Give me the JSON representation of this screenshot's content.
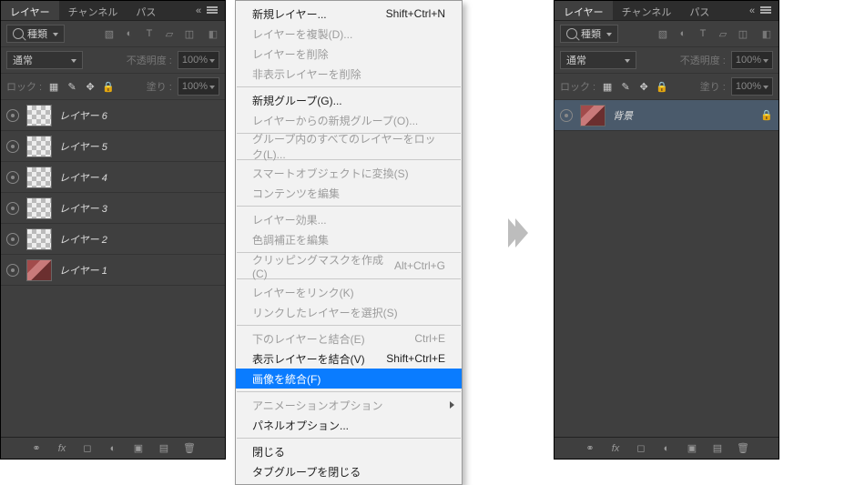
{
  "tabs": {
    "layers": "レイヤー",
    "channels": "チャンネル",
    "paths": "パス"
  },
  "filter": {
    "kind_label": "種類",
    "icons": [
      "image-icon",
      "adjust-icon",
      "type-icon",
      "shape-icon",
      "smart-icon"
    ]
  },
  "blend": {
    "mode": "通常",
    "opacity_label": "不透明度 :",
    "opacity_value": "100%"
  },
  "lock": {
    "label": "ロック :",
    "fill_label": "塗り :",
    "fill_value": "100%"
  },
  "leftLayers": [
    {
      "name": "レイヤー 6",
      "thumb": "checker"
    },
    {
      "name": "レイヤー 5",
      "thumb": "checker"
    },
    {
      "name": "レイヤー 4",
      "thumb": "checker"
    },
    {
      "name": "レイヤー 3",
      "thumb": "checker"
    },
    {
      "name": "レイヤー 2",
      "thumb": "checker"
    },
    {
      "name": "レイヤー 1",
      "thumb": "img"
    }
  ],
  "rightLayer": {
    "name": "背景",
    "locked": true
  },
  "menu": [
    {
      "t": "item",
      "label": "新規レイヤー...",
      "shortcut": "Shift+Ctrl+N"
    },
    {
      "t": "item",
      "label": "レイヤーを複製(D)...",
      "disabled": true
    },
    {
      "t": "item",
      "label": "レイヤーを削除",
      "disabled": true
    },
    {
      "t": "item",
      "label": "非表示レイヤーを削除",
      "disabled": true
    },
    {
      "t": "sep"
    },
    {
      "t": "item",
      "label": "新規グループ(G)..."
    },
    {
      "t": "item",
      "label": "レイヤーからの新規グループ(O)...",
      "disabled": true
    },
    {
      "t": "sep"
    },
    {
      "t": "item",
      "label": "グループ内のすべてのレイヤーをロック(L)...",
      "disabled": true
    },
    {
      "t": "sep"
    },
    {
      "t": "item",
      "label": "スマートオブジェクトに変換(S)",
      "disabled": true
    },
    {
      "t": "item",
      "label": "コンテンツを編集",
      "disabled": true
    },
    {
      "t": "sep"
    },
    {
      "t": "item",
      "label": "レイヤー効果...",
      "disabled": true
    },
    {
      "t": "item",
      "label": "色調補正を編集",
      "disabled": true
    },
    {
      "t": "sep"
    },
    {
      "t": "item",
      "label": "クリッピングマスクを作成(C)",
      "shortcut": "Alt+Ctrl+G",
      "disabled": true
    },
    {
      "t": "sep"
    },
    {
      "t": "item",
      "label": "レイヤーをリンク(K)",
      "disabled": true
    },
    {
      "t": "item",
      "label": "リンクしたレイヤーを選択(S)",
      "disabled": true
    },
    {
      "t": "sep"
    },
    {
      "t": "item",
      "label": "下のレイヤーと結合(E)",
      "shortcut": "Ctrl+E",
      "disabled": true
    },
    {
      "t": "item",
      "label": "表示レイヤーを結合(V)",
      "shortcut": "Shift+Ctrl+E"
    },
    {
      "t": "item",
      "label": "画像を統合(F)",
      "selected": true
    },
    {
      "t": "sep"
    },
    {
      "t": "item",
      "label": "アニメーションオプション",
      "submenu": true,
      "disabled": true
    },
    {
      "t": "item",
      "label": "パネルオプション..."
    },
    {
      "t": "sep"
    },
    {
      "t": "item",
      "label": "閉じる"
    },
    {
      "t": "item",
      "label": "タブグループを閉じる"
    }
  ],
  "footerIcons": [
    "link-icon",
    "fx-icon",
    "mask-icon",
    "fill-adjust-icon",
    "group-icon",
    "new-layer-icon",
    "trash-icon"
  ]
}
